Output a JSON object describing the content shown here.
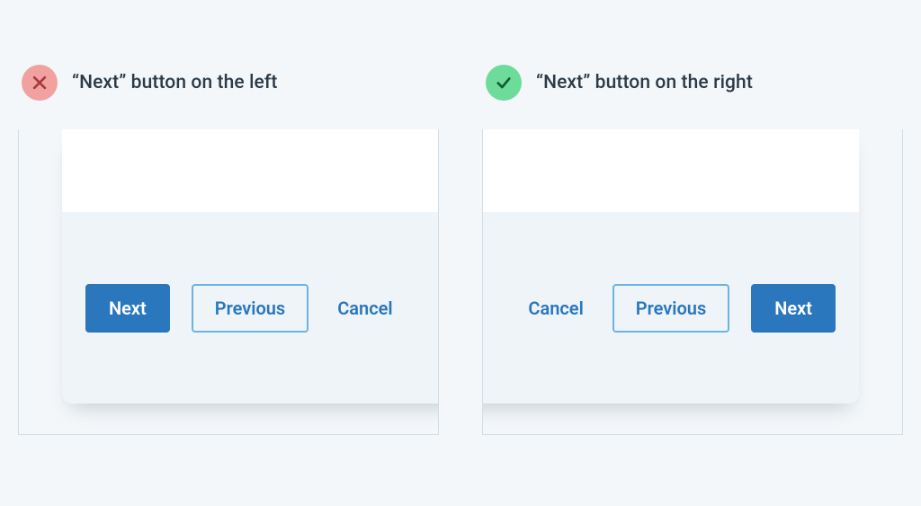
{
  "bad": {
    "caption": "“Next” button on the left",
    "buttons": {
      "next": "Next",
      "previous": "Previous",
      "cancel": "Cancel"
    }
  },
  "good": {
    "caption": "“Next” button on the right",
    "buttons": {
      "cancel": "Cancel",
      "previous": "Previous",
      "next": "Next"
    }
  },
  "colors": {
    "primary": "#2a77bd",
    "secondaryBorder": "#6fb3e0",
    "badBadge": "#f2a1a1",
    "goodBadge": "#6ddc9a",
    "pageBg": "#f3f7fa",
    "footerBg": "#eef4f8"
  }
}
